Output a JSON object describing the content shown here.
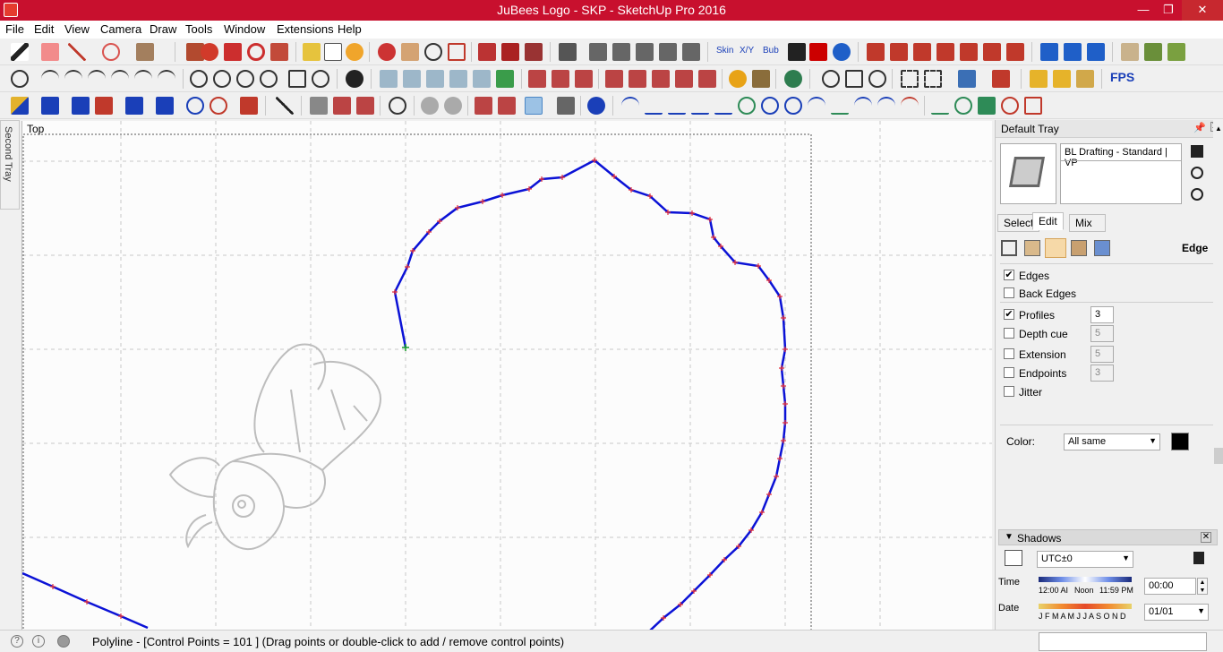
{
  "window": {
    "title": "JuBees Logo - SKP - SketchUp Pro 2016",
    "minimize": "—",
    "maximize": "❐",
    "close": "✕"
  },
  "menu": [
    "File",
    "Edit",
    "View",
    "Camera",
    "Draw",
    "Tools",
    "Window",
    "Extensions",
    "Help"
  ],
  "toolbar_labels": {
    "skin": "Skin",
    "xy": "X/Y",
    "bub": "Bub",
    "fps": "FPS"
  },
  "second_tray": {
    "label": "Second Tray"
  },
  "viewport": {
    "scene": "Top"
  },
  "default_tray": {
    "title": "Default Tray",
    "style_name": "BL Drafting - Standard | VP",
    "tabs": [
      "Select",
      "Edit",
      "Mix"
    ],
    "active_tab": "Edit",
    "section": "Edge",
    "options": [
      {
        "label": "Edges",
        "checked": true,
        "value": ""
      },
      {
        "label": "Back Edges",
        "checked": false,
        "value": ""
      },
      {
        "label": "Profiles",
        "checked": true,
        "value": "3"
      },
      {
        "label": "Depth cue",
        "checked": false,
        "value": "5"
      },
      {
        "label": "Extension",
        "checked": false,
        "value": "5"
      },
      {
        "label": "Endpoints",
        "checked": false,
        "value": "3"
      },
      {
        "label": "Jitter",
        "checked": false,
        "value": ""
      }
    ],
    "color_label": "Color:",
    "color_value": "All same",
    "color_swatch": "#000000"
  },
  "shadows": {
    "title": "Shadows",
    "timezone": "UTC±0",
    "time_label": "Time",
    "time_scale": [
      "12:00 AI",
      "Noon",
      "11:59 PM"
    ],
    "time_value": "00:00",
    "date_label": "Date",
    "date_scale": "J F M A M J J A S O N D",
    "date_value": "01/01"
  },
  "status": {
    "message": "Polyline - [Control Points = 101 ]   (Drag points or double-click to add / remove control points)"
  },
  "colors": {
    "accent": "#c8102e",
    "curve": "#0b12d6",
    "control_point": "#e8333b",
    "logo_gray": "#bdbdbd"
  }
}
